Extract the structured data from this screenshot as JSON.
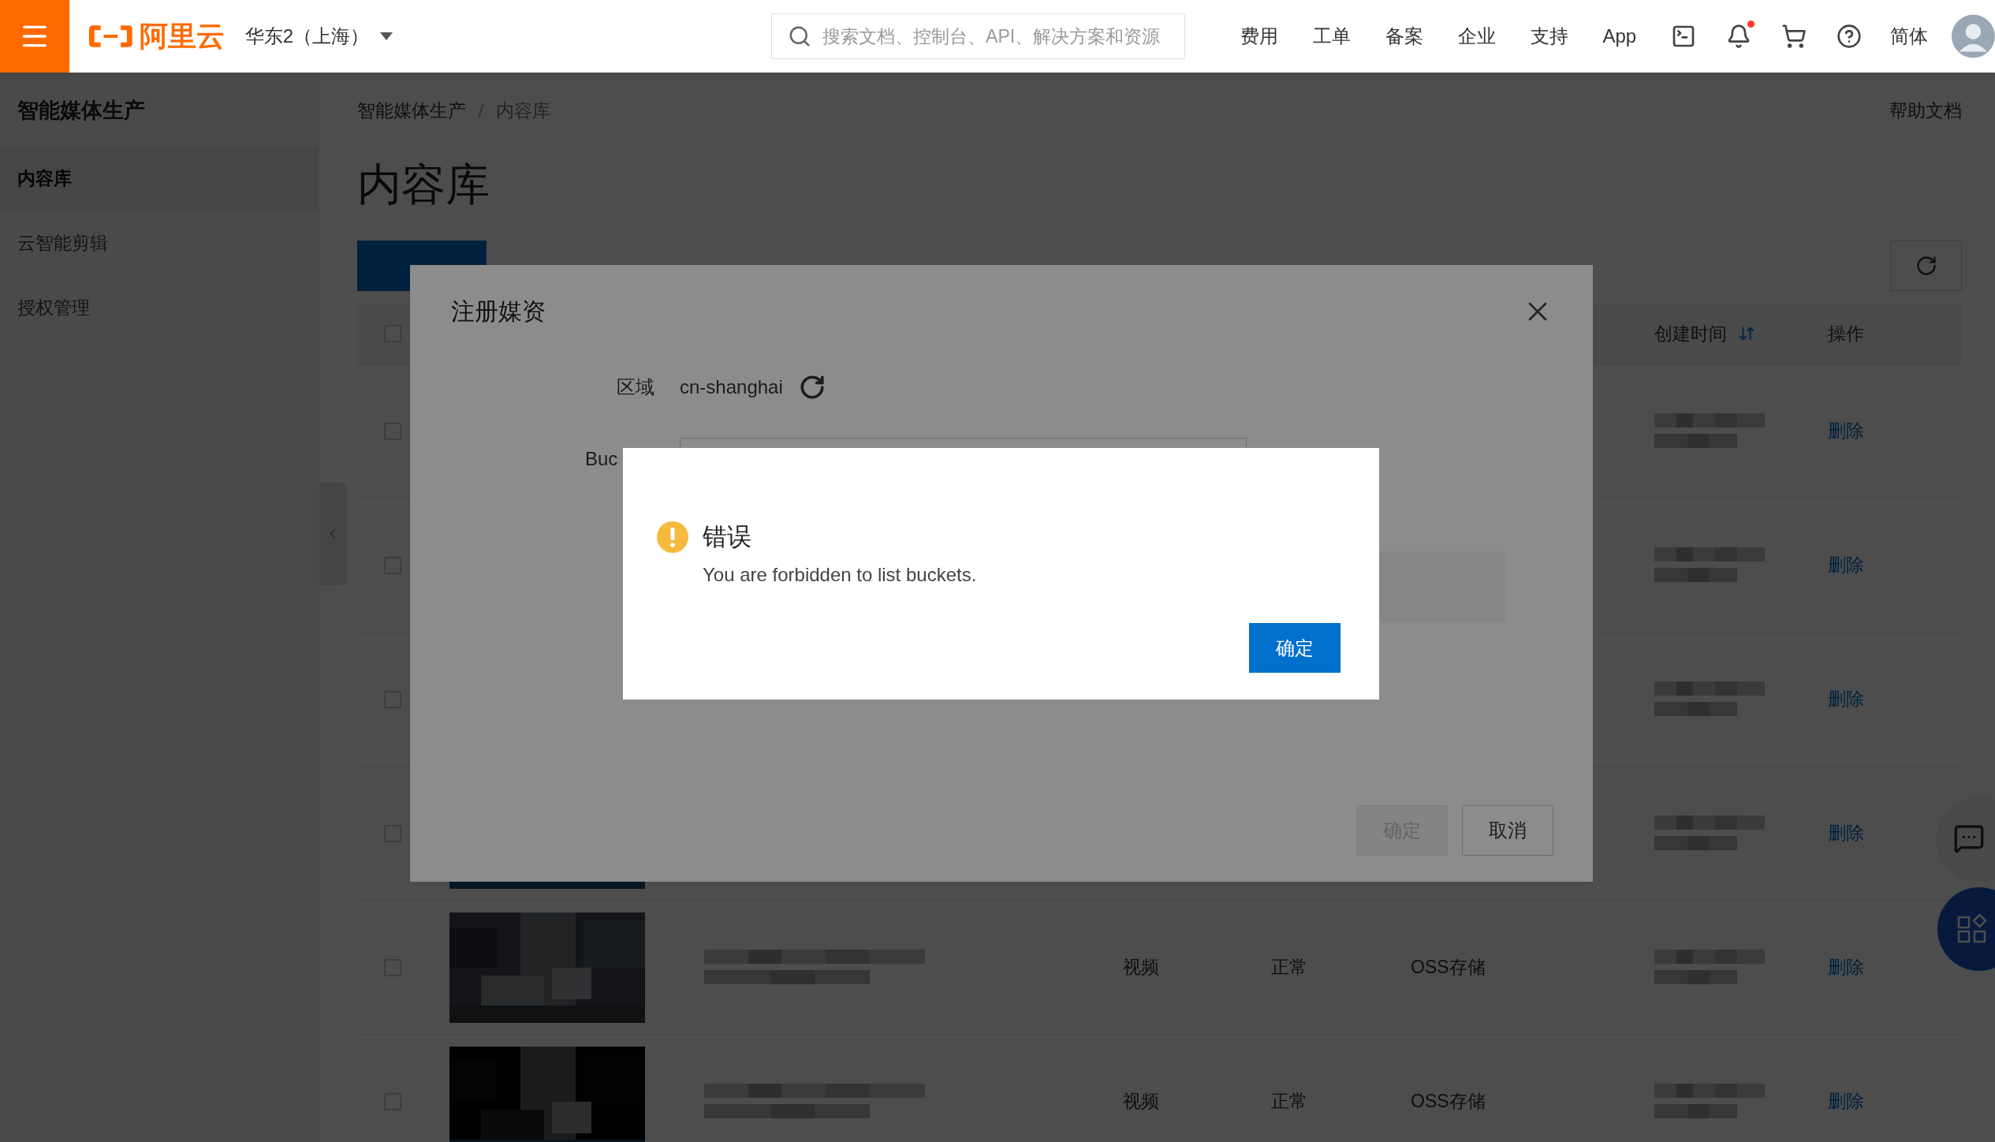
{
  "topbar": {
    "brand": "阿里云",
    "region": "华东2（上海）",
    "search": {
      "placeholder": "搜索文档、控制台、API、解决方案和资源"
    },
    "nav": [
      "费用",
      "工单",
      "备案",
      "企业",
      "支持",
      "App"
    ],
    "bell": {
      "unread": true
    },
    "language": "简体"
  },
  "sidebar": {
    "title": "智能媒体生产",
    "items": [
      {
        "label": "内容库",
        "selected": true
      },
      {
        "label": "云智能剪辑",
        "selected": false
      },
      {
        "label": "授权管理",
        "selected": false
      }
    ]
  },
  "breadcrumb": [
    "智能媒体生产",
    "内容库"
  ],
  "breadcrumb_separator": "/",
  "help_link": "帮助文档",
  "page_title": "内容库",
  "table": {
    "header_checked": false,
    "columns": [
      {
        "label": "创建时间",
        "sortable": true
      },
      {
        "label": "操作"
      }
    ],
    "rows": [
      {
        "checked": false,
        "created": {
          "kind": "redacted"
        },
        "action": "删除"
      },
      {
        "checked": false,
        "created": {
          "kind": "redacted"
        },
        "action": "删除"
      },
      {
        "checked": false,
        "created": {
          "kind": "redacted"
        },
        "action": "删除"
      },
      {
        "checked": false,
        "created": {
          "kind": "redacted"
        },
        "action": "删除"
      },
      {
        "checked": false,
        "name": {
          "kind": "redacted"
        },
        "type": "视频",
        "status": "正常",
        "storage": "OSS存储",
        "created": {
          "kind": "redacted"
        },
        "action": "删除"
      },
      {
        "checked": false,
        "name": {
          "kind": "redacted"
        },
        "type": "视频",
        "status": "正常",
        "storage": "OSS存储",
        "created": {
          "kind": "redacted"
        },
        "action": "删除"
      }
    ]
  },
  "register_dialog": {
    "title": "注册媒资",
    "region_label": "区域",
    "region_value": "cn-shanghai",
    "bucket_label": "Buc",
    "buttons": [
      {
        "label": "确定",
        "disabled": true
      },
      {
        "label": "取消",
        "disabled": false
      }
    ]
  },
  "error_dialog": {
    "title": "错误",
    "message": "You are forbidden to list buckets.",
    "button": "确定"
  }
}
